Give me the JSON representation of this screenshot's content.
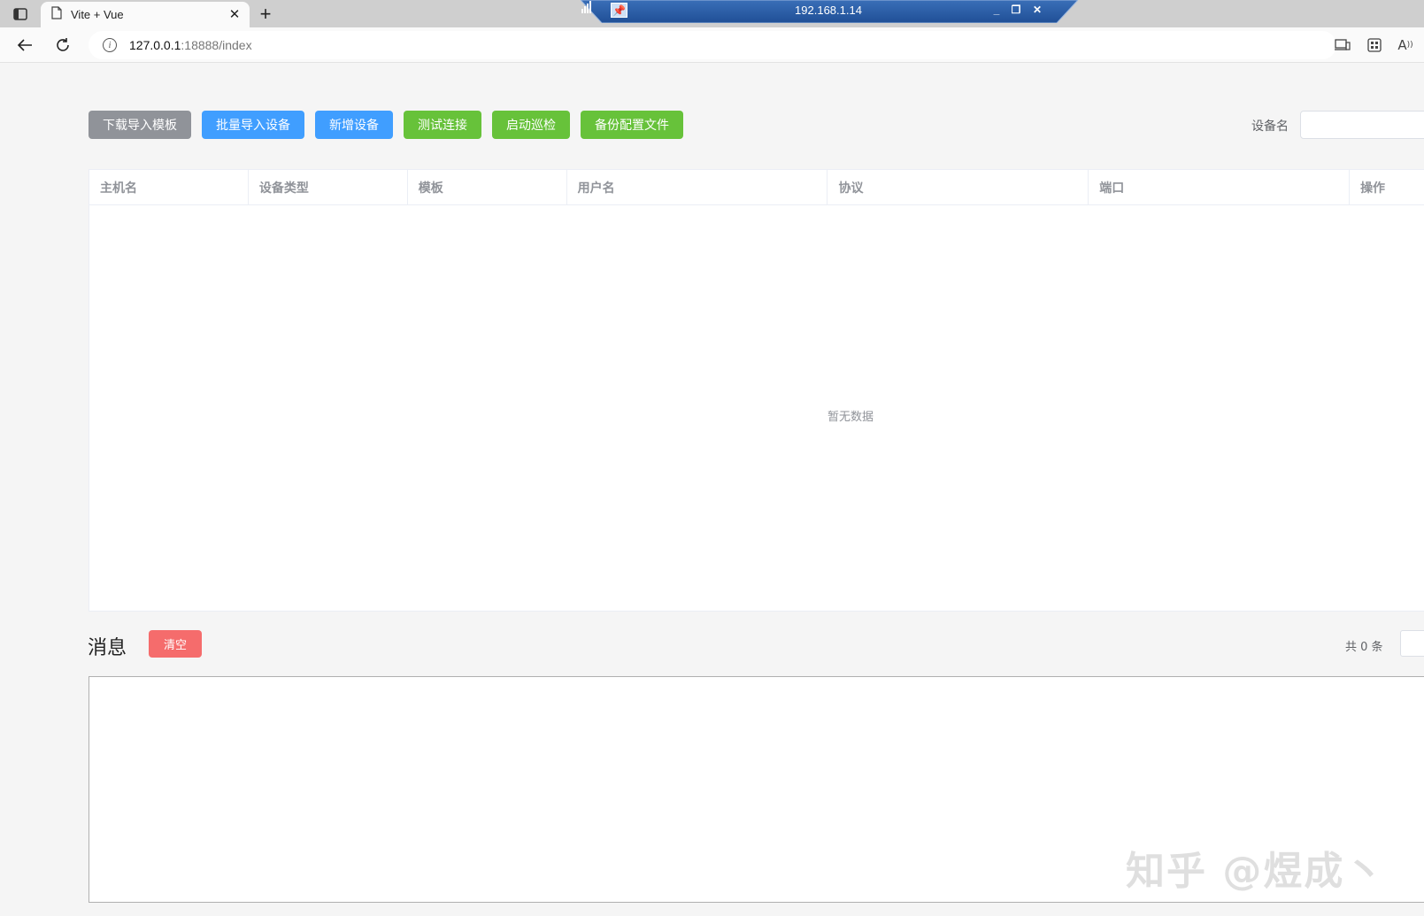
{
  "browser": {
    "tab_title": "Vite + Vue",
    "url_host": "127.0.0.1",
    "url_path": ":18888/index",
    "remote_session_title": "192.168.1.14"
  },
  "toolbar": {
    "buttons": [
      {
        "label": "下载导入模板",
        "color": "#909399"
      },
      {
        "label": "批量导入设备",
        "color": "#409eff"
      },
      {
        "label": "新增设备",
        "color": "#409eff"
      },
      {
        "label": "测试连接",
        "color": "#67c23a"
      },
      {
        "label": "启动巡检",
        "color": "#67c23a"
      },
      {
        "label": "备份配置文件",
        "color": "#67c23a"
      }
    ],
    "search_label": "设备名",
    "search_value": ""
  },
  "table": {
    "columns": [
      "主机名",
      "设备类型",
      "模板",
      "用户名",
      "协议",
      "端口",
      "操作"
    ],
    "rows": [],
    "empty_text": "暂无数据"
  },
  "messages": {
    "title": "消息",
    "clear_label": "清空",
    "clear_color": "#f56c6c",
    "total_label": "共 0 条",
    "content": ""
  },
  "watermark": "知乎 @煜成丶"
}
